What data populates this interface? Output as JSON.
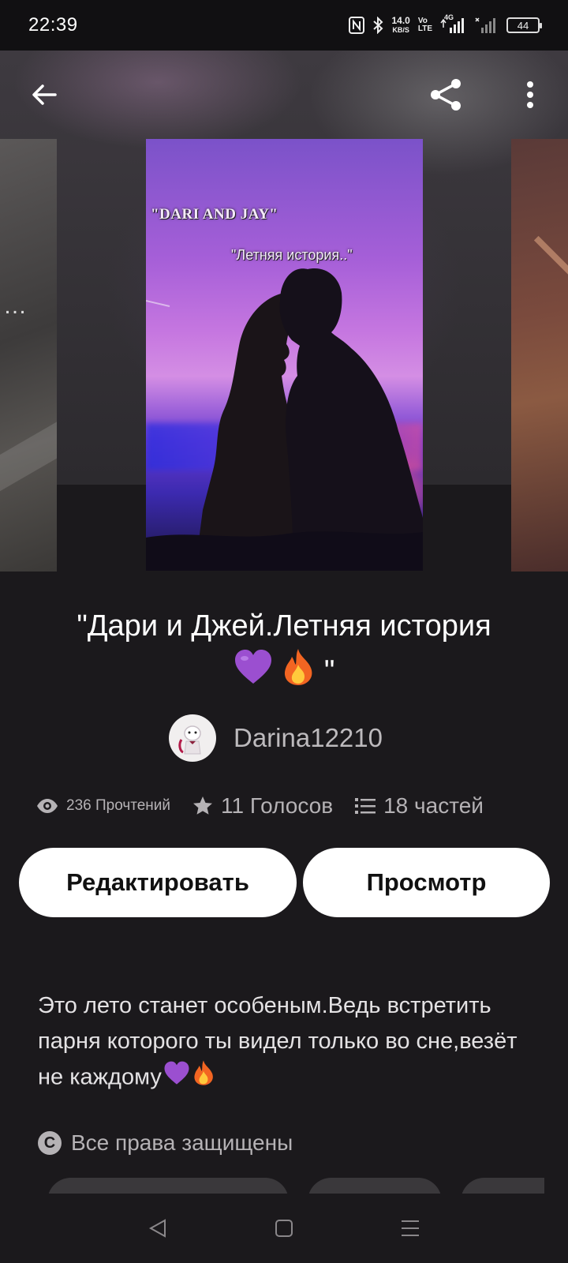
{
  "status_bar": {
    "time": "22:39",
    "net_speed_value": "14.0",
    "net_speed_unit": "KB/S",
    "volte_top": "Vo",
    "volte_bottom": "LTE",
    "network_type": "4G",
    "battery": "44"
  },
  "cover": {
    "line1": "\"DARI AND JAY\"",
    "line2": "\"Летняя история..\""
  },
  "story": {
    "title": "\"Дари и Джей.Летняя история",
    "title_end": "\"",
    "author": "Darina12210",
    "reads": "236 Прочтений",
    "votes": "11 Голосов",
    "parts": "18 частей",
    "description": "Это лето станет особеным.Ведь встретить парня которого ты видел только во сне,везёт не каждому",
    "rights": "Все права защищены"
  },
  "actions": {
    "edit_label": "Редактировать",
    "view_label": "Просмотр"
  },
  "colors": {
    "background": "#1b191c",
    "button": "#ffffff",
    "muted_text": "#b5b2b5"
  },
  "icons": [
    "back-arrow-icon",
    "share-icon",
    "more-vert-icon",
    "eye-icon",
    "star-icon",
    "list-icon",
    "copyright-icon",
    "purple-heart-emoji",
    "fire-emoji",
    "nav-back-icon",
    "nav-home-icon",
    "nav-menu-icon"
  ]
}
